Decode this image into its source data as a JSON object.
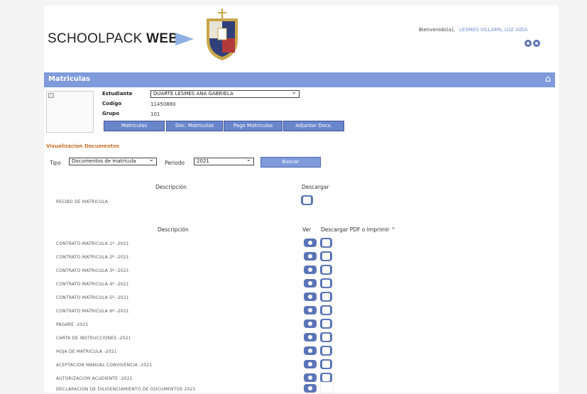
{
  "header": {
    "logo_text": "SCHOOLPACK",
    "logo_bold": "WEB",
    "welcome_label": "Bienvenido(a),",
    "user_name": "LESMES VILLAMIL LUZ AIDA"
  },
  "bar": {
    "title": "Matriculas"
  },
  "student": {
    "estudiante_label": "Estudiante",
    "estudiante_value": "DUARTE LESMES ANA GABRIELA",
    "codigo_label": "Codigo",
    "codigo_value": "11450880",
    "grupo_label": "Grupo",
    "grupo_value": "101"
  },
  "tabs": [
    "Matriculas",
    "Doc. Matriculas",
    "Pago Matriculas",
    "Adjuntar Docs."
  ],
  "section_title": "Visualizacion Documentos",
  "filters": {
    "tipo_label": "Tipo",
    "tipo_value": "Documentos de matricula",
    "periodo_label": "Periodo",
    "periodo_value": "2021",
    "buscar_label": "Buscar"
  },
  "table1": {
    "col_desc": "Descripción",
    "col_download": "Descargar",
    "rows": [
      "RECIBO DE MATRICULA"
    ]
  },
  "table2": {
    "col_desc": "Descripción",
    "col_ver": "Ver",
    "col_download": "Descargar PDF o Imprimir ^",
    "rows": [
      {
        "text": "CONTRATO MATRICULA 1º -2021",
        "download": true
      },
      {
        "text": "CONTRATO MATRICULA 2º -2021",
        "download": true
      },
      {
        "text": "CONTRATO MATRICULA 3º -2021",
        "download": true
      },
      {
        "text": "CONTRATO MATRICULA 4º -2021",
        "download": true
      },
      {
        "text": "CONTRATO MATRICULA 5º -2021",
        "download": true
      },
      {
        "text": "CONTRATO MATRICULA 6º -2021",
        "download": true
      },
      {
        "text": "PAGARE -2021",
        "download": true
      },
      {
        "text": "CARTA DE INSTRUCCIONES -2021",
        "download": true
      },
      {
        "text": "HOJA DE MATRICULA -2021",
        "download": true
      },
      {
        "text": "ACEPTACION MANUAL CONVIVENCIA -2021",
        "download": true
      },
      {
        "text": "AUTORIZACION ACUDIENTE -2021",
        "download": true
      },
      {
        "text": "DECLARACION DE DILIGENCIAMIENTO DE DOCUMENTOS 2021",
        "download": false
      }
    ]
  }
}
